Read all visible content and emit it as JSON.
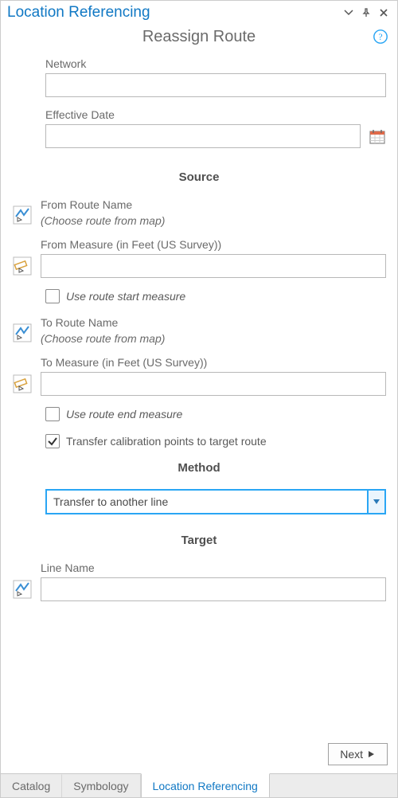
{
  "header": {
    "title": "Location Referencing",
    "page_title": "Reassign Route"
  },
  "form": {
    "network_label": "Network",
    "network_value": "",
    "effdate_label": "Effective Date",
    "effdate_value": ""
  },
  "sections": {
    "source": "Source",
    "method": "Method",
    "target": "Target"
  },
  "source": {
    "from_route_label": "From Route Name",
    "from_route_hint": "(Choose route from map)",
    "from_measure_label": "From Measure (in Feet (US Survey))",
    "from_measure_value": "",
    "use_start_label": "Use route start measure",
    "use_start_checked": false,
    "to_route_label": "To Route Name",
    "to_route_hint": "(Choose route from map)",
    "to_measure_label": "To Measure (in Feet (US Survey))",
    "to_measure_value": "",
    "use_end_label": "Use route end measure",
    "use_end_checked": false,
    "transfer_label": "Transfer calibration points to target route",
    "transfer_checked": true
  },
  "method": {
    "selected": "Transfer to another line"
  },
  "target": {
    "line_name_label": "Line Name",
    "line_name_value": ""
  },
  "buttons": {
    "next": "Next"
  },
  "tabs": {
    "items": [
      {
        "label": "Catalog",
        "active": false
      },
      {
        "label": "Symbology",
        "active": false
      },
      {
        "label": "Location Referencing",
        "active": true
      }
    ]
  }
}
